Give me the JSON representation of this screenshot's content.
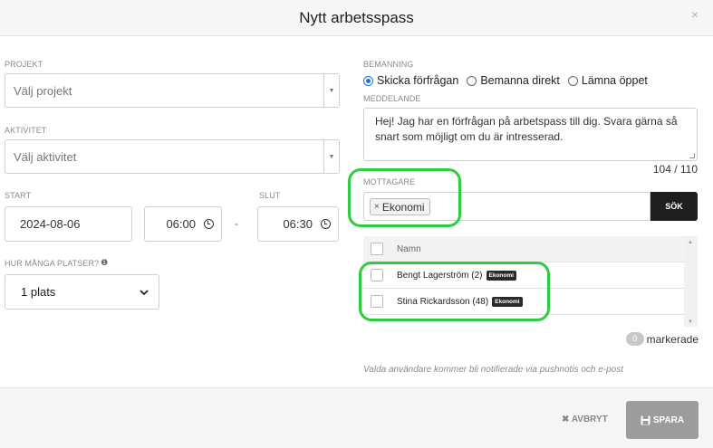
{
  "modal": {
    "title": "Nytt arbetsspass",
    "close_icon": "×"
  },
  "form": {
    "project": {
      "label": "PROJEKT",
      "placeholder": "Välj projekt"
    },
    "activity": {
      "label": "AKTIVITET",
      "placeholder": "Välj aktivitet"
    },
    "start": {
      "label": "START",
      "date": "2024-08-06",
      "time": "06:00"
    },
    "end": {
      "label": "SLUT",
      "time": "06:30"
    },
    "range_separator": "-",
    "seats": {
      "label": "HUR MÅNGA PLATSER?",
      "help_icon": "❶",
      "value": "1 plats"
    }
  },
  "staffing": {
    "label": "BEMANNING",
    "options": [
      {
        "label": "Skicka förfrågan",
        "checked": true
      },
      {
        "label": "Bemanna direkt",
        "checked": false
      },
      {
        "label": "Lämna öppet",
        "checked": false
      }
    ]
  },
  "message": {
    "label": "MEDDELANDE",
    "text": "Hej! Jag har en förfrågan på arbetspass till dig. Svara gärna så snart som möjligt om du är intresserad.",
    "counter": "104 / 110"
  },
  "recipients": {
    "label": "MOTTAGARE",
    "chips": [
      {
        "remove": "×",
        "label": "Ekonomi"
      }
    ],
    "search_button": "SÖK"
  },
  "table": {
    "header": "Namn",
    "rows": [
      {
        "name": "Bengt Lagerström (2)",
        "tag": "Ekonomi"
      },
      {
        "name": "Stina Rickardsson (48)",
        "tag": "Ekonomi"
      }
    ]
  },
  "selection": {
    "count": "0",
    "label": "markerade"
  },
  "notice": "Valda användare kommer bli notifierade via pushnotis och e-post",
  "footer": {
    "cancel_label": "AVBRYT",
    "save_label": "SPARA"
  },
  "colors": {
    "highlight": "#2ecc40",
    "radio_accent": "#1a73e8"
  }
}
